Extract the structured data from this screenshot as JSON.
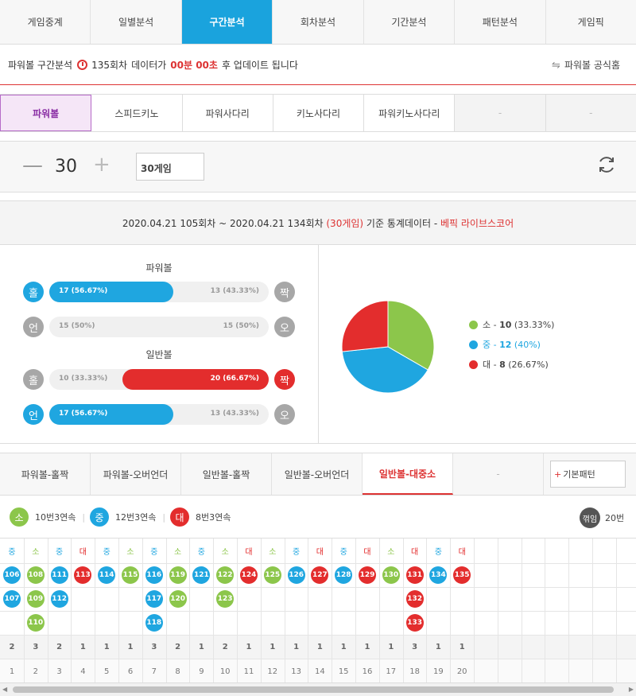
{
  "nav": {
    "tabs": [
      "게임중계",
      "일별분석",
      "구간분석",
      "회차분석",
      "기간분석",
      "패턴분석",
      "게임픽"
    ],
    "active": 2
  },
  "info": {
    "prefix": "파워볼 구간분석",
    "round": "135회차",
    "mid": "데이터가",
    "countdown": "00분 00초",
    "suffix": "후 업데이트 됩니다",
    "official": "파워볼 공식홈"
  },
  "games": {
    "tabs": [
      "파워볼",
      "스피드키노",
      "파워사다리",
      "키노사다리",
      "파워키노사다리",
      "-",
      "-"
    ],
    "active": 0
  },
  "counter": {
    "minus": "—",
    "value": "30",
    "plus": "+",
    "select": "30게임"
  },
  "stats_header": {
    "range": "2020.04.21 105회차 ~ 2020.04.21 134회차",
    "games": "(30게임)",
    "basis": "기준 통계데이터 -",
    "brand": "베픽 라이브스코어"
  },
  "powerball": {
    "title": "파워볼",
    "odd_label": "홀",
    "even_label": "짝",
    "odd": "17 (56.67%)",
    "even": "13 (43.33%)",
    "odd_pct": 56.67,
    "under_label": "언",
    "over_label": "오",
    "under": "15 (50%)",
    "over": "15 (50%)",
    "under_pct": 50
  },
  "normal": {
    "title": "일반볼",
    "odd_label": "홀",
    "even_label": "짝",
    "odd": "10 (33.33%)",
    "even": "20 (66.67%)",
    "even_pct": 66.67,
    "under_label": "언",
    "over_label": "오",
    "under": "17 (56.67%)",
    "over": "13 (43.33%)",
    "under_pct": 56.67
  },
  "pie": {
    "slices": [
      {
        "label": "소",
        "count": "10",
        "pct": "(33.33%)",
        "value": 10,
        "color": "#8cc64b"
      },
      {
        "label": "중",
        "count": "12",
        "pct": "(40%)",
        "value": 12,
        "color": "#1fa6e0"
      },
      {
        "label": "대",
        "count": "8",
        "pct": "(26.67%)",
        "value": 8,
        "color": "#e32d2d"
      }
    ],
    "sep": "-"
  },
  "pattern_tabs": {
    "tabs": [
      "파워볼-홀짝",
      "파워볼-오버언더",
      "일반볼-홀짝",
      "일반볼-오버언더",
      "일반볼-대중소",
      "-"
    ],
    "active": 4,
    "basic_button": "기본패턴",
    "basic_plus": "+"
  },
  "summary": {
    "small_label": "소",
    "small": "10번3연속",
    "mid_label": "중",
    "mid": "12번3연속",
    "big_label": "대",
    "big": "8번3연속",
    "flip_label": "꺾임",
    "flip": "20번",
    "sep": "|"
  },
  "colors": {
    "small": "#8cc64b",
    "mid": "#1fa6e0",
    "big": "#e32d2d",
    "accent": "#1aa3dd",
    "red": "#d33333"
  },
  "grid": {
    "columns": [
      {
        "h": "중",
        "balls": [
          "106",
          "107"
        ],
        "count": "2",
        "idx": "1"
      },
      {
        "h": "소",
        "balls": [
          "108",
          "109",
          "110"
        ],
        "count": "3",
        "idx": "2"
      },
      {
        "h": "중",
        "balls": [
          "111",
          "112"
        ],
        "count": "2",
        "idx": "3"
      },
      {
        "h": "대",
        "balls": [
          "113"
        ],
        "count": "1",
        "idx": "4"
      },
      {
        "h": "중",
        "balls": [
          "114"
        ],
        "count": "1",
        "idx": "5"
      },
      {
        "h": "소",
        "balls": [
          "115"
        ],
        "count": "1",
        "idx": "6"
      },
      {
        "h": "중",
        "balls": [
          "116",
          "117",
          "118"
        ],
        "count": "3",
        "idx": "7"
      },
      {
        "h": "소",
        "balls": [
          "119",
          "120"
        ],
        "count": "2",
        "idx": "8"
      },
      {
        "h": "중",
        "balls": [
          "121"
        ],
        "count": "1",
        "idx": "9"
      },
      {
        "h": "소",
        "balls": [
          "122",
          "123"
        ],
        "count": "2",
        "idx": "10"
      },
      {
        "h": "대",
        "balls": [
          "124"
        ],
        "count": "1",
        "idx": "11"
      },
      {
        "h": "소",
        "balls": [
          "125"
        ],
        "count": "1",
        "idx": "12"
      },
      {
        "h": "중",
        "balls": [
          "126"
        ],
        "count": "1",
        "idx": "13"
      },
      {
        "h": "대",
        "balls": [
          "127"
        ],
        "count": "1",
        "idx": "14"
      },
      {
        "h": "중",
        "balls": [
          "128"
        ],
        "count": "1",
        "idx": "15"
      },
      {
        "h": "대",
        "balls": [
          "129"
        ],
        "count": "1",
        "idx": "16"
      },
      {
        "h": "소",
        "balls": [
          "130"
        ],
        "count": "1",
        "idx": "17"
      },
      {
        "h": "대",
        "balls": [
          "131",
          "132",
          "133"
        ],
        "count": "3",
        "idx": "18"
      },
      {
        "h": "중",
        "balls": [
          "134"
        ],
        "count": "1",
        "idx": "19"
      },
      {
        "h": "대",
        "balls": [
          "135"
        ],
        "count": "1",
        "idx": "20"
      }
    ]
  }
}
